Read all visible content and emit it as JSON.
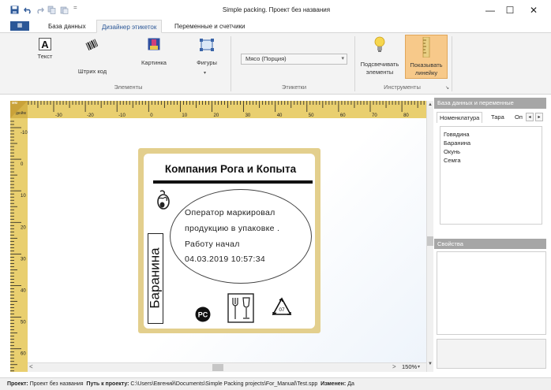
{
  "window": {
    "title": "Simple packing. Проект без названия",
    "controls": [
      "minimize",
      "maximize",
      "close"
    ]
  },
  "ribbon": {
    "tabs": [
      "База данных",
      "Дизайнер этикеток",
      "Переменные и счетчики"
    ],
    "active_tab": "Дизайнер этикеток",
    "elements_group": {
      "label": "Элементы",
      "buttons": [
        "Текст",
        "Штрих код",
        "Картинка",
        "Фигуры"
      ]
    },
    "labels_group": {
      "label": "Этикетки",
      "combo_value": "Мясо (Порция)"
    },
    "tools_group": {
      "label": "Инструменты",
      "buttons": [
        "Подсвечивать элементы",
        "Показывать линейку"
      ]
    }
  },
  "ruler": {
    "unit": "дюйм",
    "unit_abbr": "мм",
    "h_labels": [
      "-30",
      "-20",
      "-10",
      "0",
      "10",
      "20",
      "30",
      "40",
      "50",
      "60",
      "70",
      "80",
      "90"
    ],
    "v_labels": [
      "-10",
      "0",
      "10",
      "20",
      "30",
      "40",
      "50",
      "60",
      "70"
    ]
  },
  "label": {
    "company": "Компания Рога и Копыта",
    "lines": [
      "Оператор маркировал",
      "продукцию в упаковке .",
      "Работу начал",
      "04.03.2019 10:57:34"
    ],
    "product": "Баранина",
    "recycle_code": "07"
  },
  "zoom": "150%",
  "right_panel": {
    "title": "База данных и переменные",
    "tabs": [
      "Номенклатура",
      "Тара",
      "Оп"
    ],
    "active_tab": "Номенклатура",
    "items": [
      "Говядина",
      "Баранина",
      "Окунь",
      "Семга"
    ],
    "properties_title": "Свойства"
  },
  "status": {
    "project_label": "Проект:",
    "project_value": "Проект без названия",
    "path_label": "Путь к проекту:",
    "path_value": "C:\\Users\\Евгений\\Documents\\Simple Packing projects\\For_Manual\\Test.spp",
    "changed_label": "Изменен:",
    "changed_value": "Да"
  }
}
